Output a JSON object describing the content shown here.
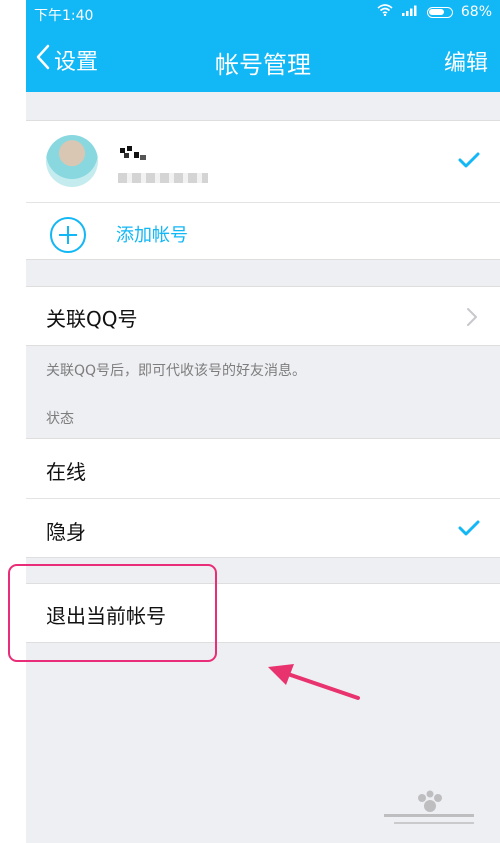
{
  "status_bar": {
    "time": "下午1:40",
    "battery": "68%"
  },
  "nav": {
    "back_label": "设置",
    "title": "帐号管理",
    "edit_label": "编辑"
  },
  "accounts": {
    "add_label": "添加帐号"
  },
  "linked_qq": {
    "label": "关联QQ号",
    "description": "关联QQ号后，即可代收该号的好友消息。"
  },
  "status": {
    "header": "状态",
    "options": [
      "在线",
      "隐身"
    ],
    "selected": "隐身"
  },
  "logout": {
    "label": "退出当前帐号"
  },
  "colors": {
    "accent": "#12b7f5",
    "highlight": "#ea2d78"
  },
  "icons": [
    "wifi-icon",
    "signal-icon",
    "battery-icon",
    "chevron-left-icon",
    "check-icon",
    "plus-circle-icon",
    "chevron-right-icon",
    "arrow-annotation"
  ]
}
